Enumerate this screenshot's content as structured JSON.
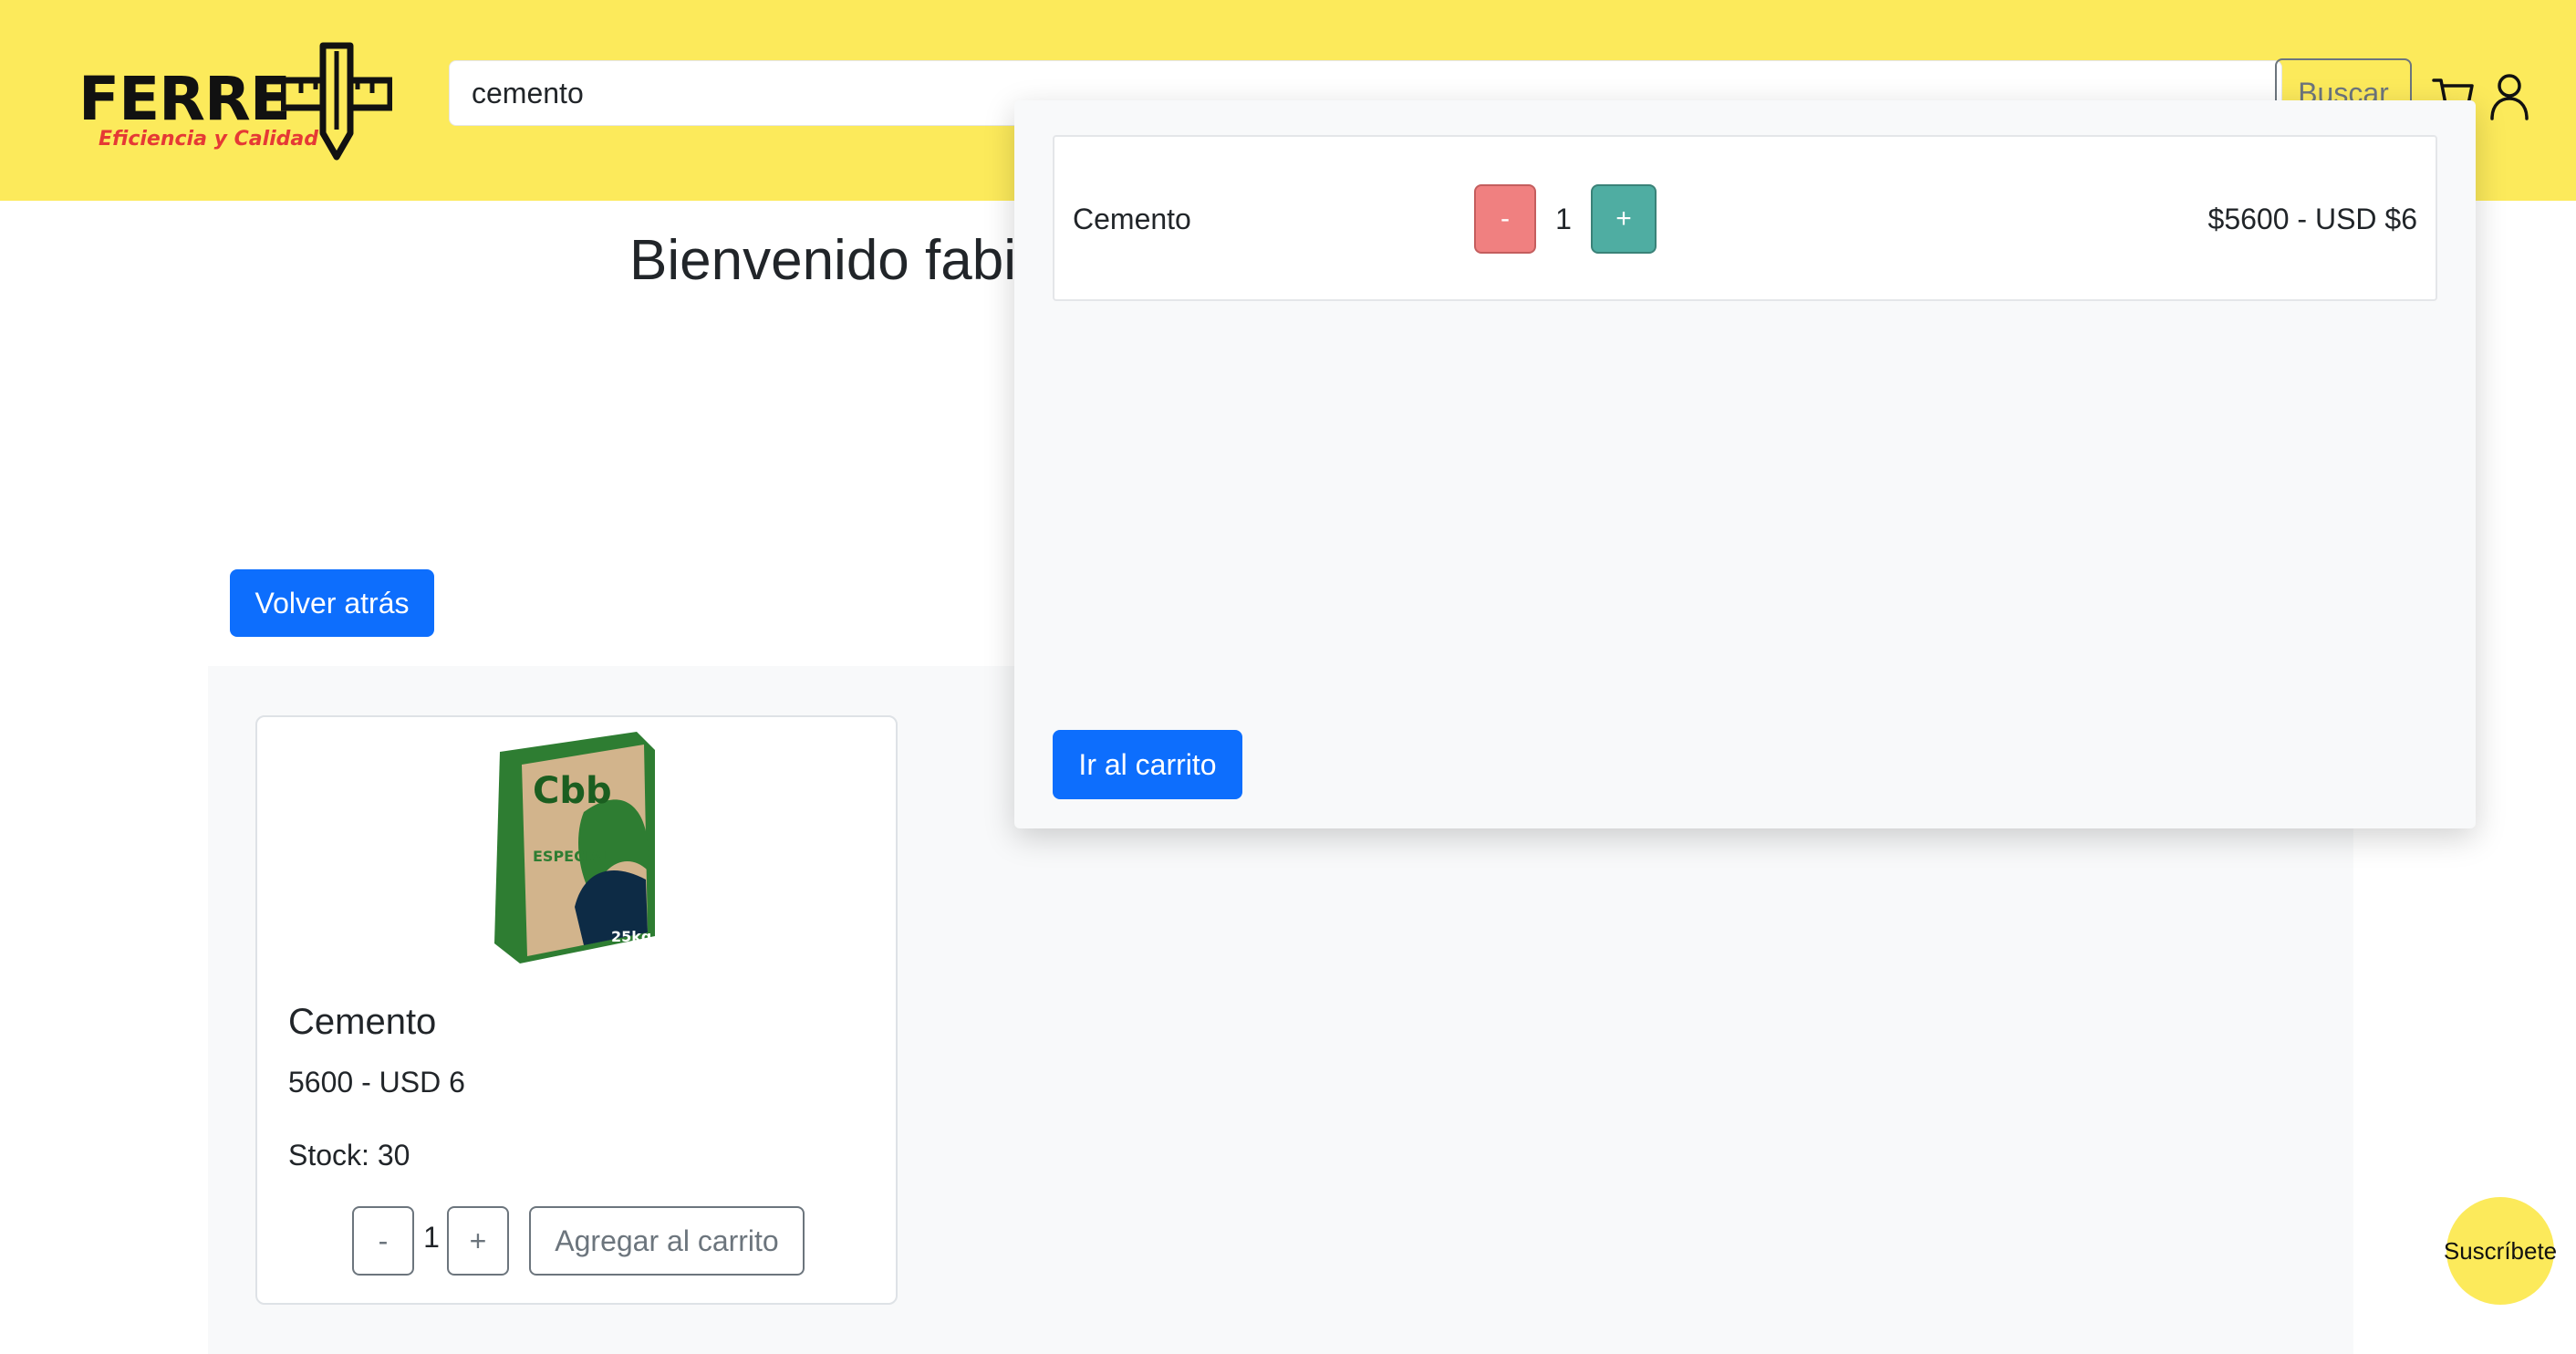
{
  "header": {
    "logo_word": "FERRE",
    "logo_tagline": "Eficiencia y Calidad",
    "search_value": "cemento",
    "search_button_label": "Buscar",
    "icons": [
      "ruler-pencil-logo-icon",
      "cart-icon",
      "user-icon"
    ]
  },
  "main": {
    "welcome_text": "Bienvenido fabi",
    "back_button_label": "Volver atrás",
    "products": [
      {
        "name": "Cemento",
        "price": "5600 - USD 6",
        "stock": "Stock: 30",
        "qty_minus": "-",
        "quantity": "1",
        "qty_plus": "+",
        "add_label": "Agregar al carrito"
      }
    ]
  },
  "cart": {
    "items": [
      {
        "name": "Cemento",
        "minus": "-",
        "quantity": "1",
        "plus": "+",
        "price": "$5600 - USD $6"
      }
    ],
    "go_cart_label": "Ir al carrito"
  },
  "subscribe_label": "Suscríbete",
  "colors": {
    "header_bg": "#fcea5b",
    "primary": "#0d6efd",
    "minus_button": "#f08080",
    "plus_button": "#4fada2",
    "logo_tagline": "#e53935"
  }
}
